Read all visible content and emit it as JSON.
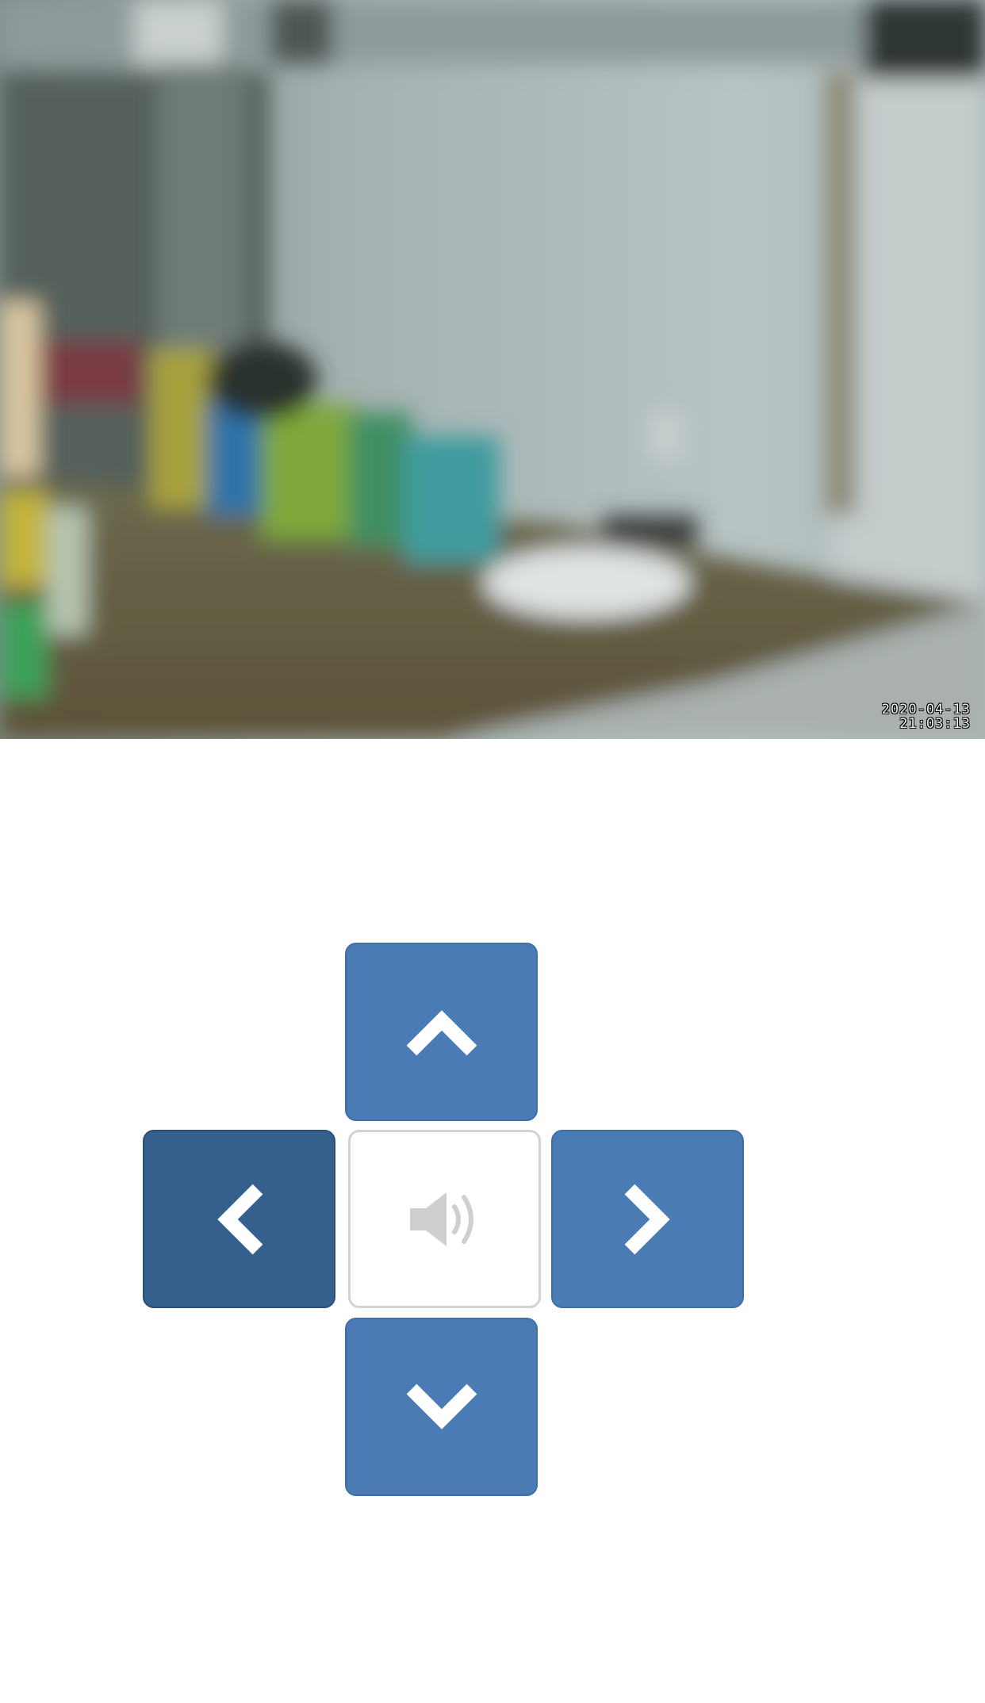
{
  "camera_feed": {
    "timestamp": {
      "date": "2020-04-13",
      "time": "21:03:13"
    }
  },
  "controls": {
    "up_icon": "chevron-up-icon",
    "left_icon": "chevron-left-icon",
    "right_icon": "chevron-right-icon",
    "down_icon": "chevron-down-icon",
    "center_icon": "speaker-icon",
    "colors": {
      "button_blue": "#4a7bb5",
      "button_pressed": "#355f8d",
      "center_border": "#d2d2d2",
      "speaker_gray": "#cfcfcf"
    }
  }
}
